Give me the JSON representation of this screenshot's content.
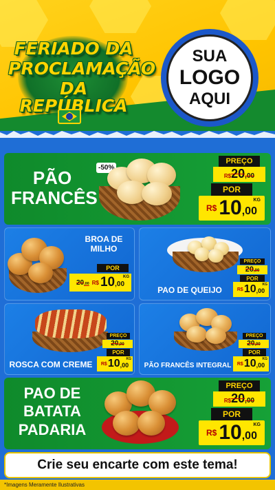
{
  "header": {
    "title_line1": "FERIADO DA",
    "title_line2": "PROCLAMAÇÃO",
    "title_line3": "DA REPÚBLICA",
    "logo_line1": "SUA",
    "logo_line2": "LOGO",
    "logo_line3": "AQUI"
  },
  "products": [
    {
      "name_line1": "PÃO",
      "name_line2": "FRANCÊS",
      "badge": "-50%",
      "price_label": "PREÇO",
      "old_price": "20",
      "old_cents": ",00",
      "por_label": "POR",
      "currency": "R$",
      "price": "10",
      "cents": ",00",
      "unit": "KG"
    },
    {
      "name_line1": "BROA DE",
      "name_line2": "MILHO",
      "por_label": "POR",
      "currency": "R$",
      "old_price": "20",
      "old_cents": ",00",
      "price": "10",
      "cents": ",00",
      "unit": "KG"
    },
    {
      "name": "PAO DE QUEIJO",
      "price_label": "PREÇO",
      "old_price": "20",
      "old_cents": ",00",
      "por_label": "POR",
      "currency": "R$",
      "price": "10",
      "cents": ",00",
      "unit": "KG"
    },
    {
      "name": "ROSCA COM CREME",
      "price_label": "PREÇO",
      "old_price": "20",
      "old_cents": ",00",
      "por_label": "POR",
      "currency": "R$",
      "price": "10",
      "cents": ",00",
      "unit": "KG"
    },
    {
      "name": "PÃO FRANCÊS INTEGRAL",
      "price_label": "PREÇO",
      "old_price": "20",
      "old_cents": ",00",
      "por_label": "POR",
      "currency": "R$",
      "price": "10",
      "cents": ",00",
      "unit": "KG"
    },
    {
      "name_line1": "PAO DE",
      "name_line2": "BATATA",
      "name_line3": "PADARIA",
      "price_label": "PREÇO",
      "old_price": "20",
      "old_cents": ",00",
      "por_label": "POR",
      "currency": "R$",
      "price": "10",
      "cents": ",00",
      "unit": "KG"
    }
  ],
  "cta": "Crie seu encarte com este tema!",
  "footer": "*Imagens Meramente Ilustrativas",
  "colors": {
    "brand_yellow": "#ffd400",
    "brand_green": "#148a2e",
    "brand_blue": "#1f6ed6",
    "price_red": "#b30000"
  }
}
